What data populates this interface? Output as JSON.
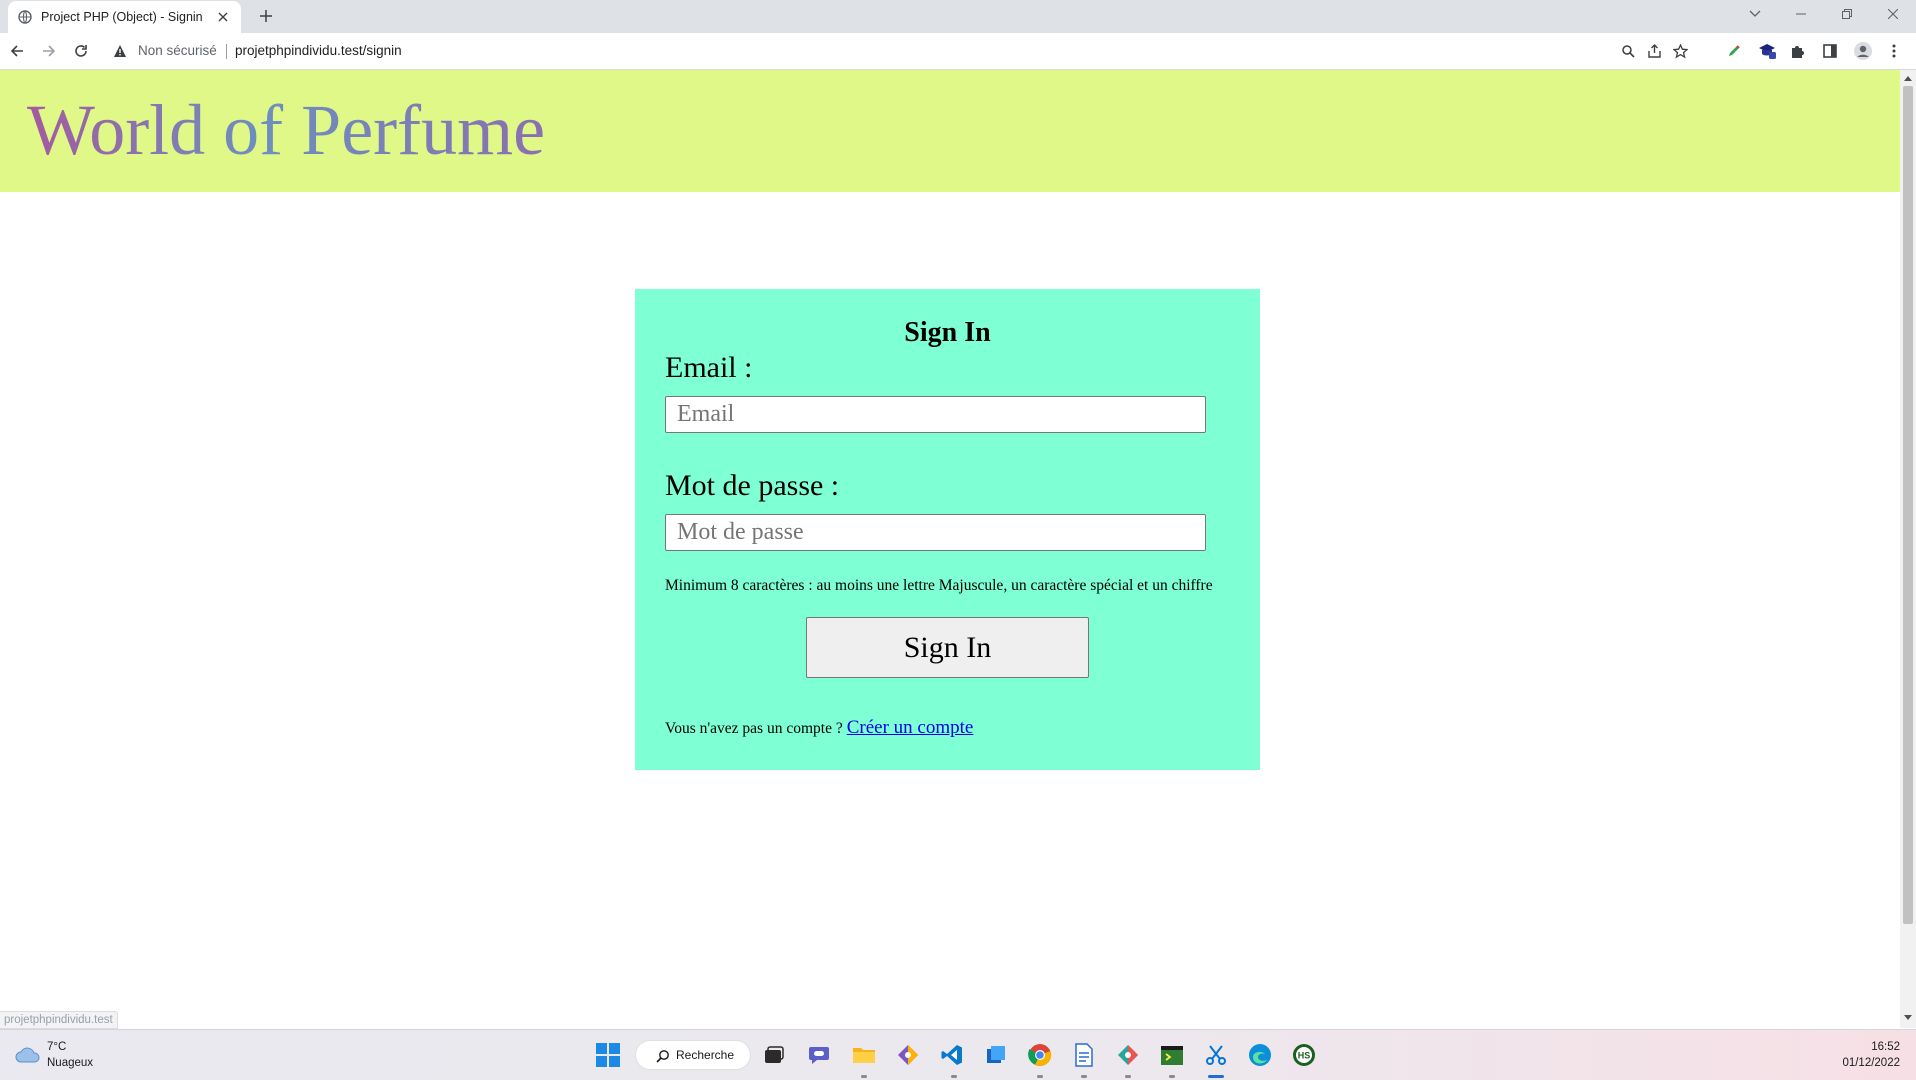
{
  "browser": {
    "tab_title": "Project PHP (Object) - Signin",
    "security_label": "Non sécurisé",
    "url": "projetphpindividu.test/signin",
    "status_url": "projetphpindividu.test"
  },
  "header": {
    "site_title": "World of Perfume"
  },
  "form": {
    "title": "Sign In",
    "email_label": "Email :",
    "email_placeholder": "Email",
    "password_label": "Mot de passe :",
    "password_placeholder": "Mot de passe",
    "password_hint": "Minimum 8 caractères : au moins une lettre Majuscule, un caractère spécial et un chiffre",
    "submit_label": "Sign In",
    "signup_question": "Vous n'avez pas un compte ?",
    "signup_link": "Créer un compte"
  },
  "taskbar": {
    "weather_temp": "7°C",
    "weather_desc": "Nuageux",
    "search_label": "Recherche",
    "time": "16:52",
    "date": "01/12/2022",
    "apps": [
      "start-icon",
      "task-view-icon",
      "teams-chat-icon",
      "file-explorer-icon",
      "git-client-icon",
      "vscode-icon",
      "office-icon",
      "chrome-icon",
      "notepad-icon",
      "git-client-icon-2",
      "terminal-icon",
      "snipping-tool-icon",
      "edge-icon",
      "hs-app-icon"
    ]
  },
  "colors": {
    "header_bg": "#dff887",
    "card_bg": "#7fffd4",
    "link": "#0000ee"
  }
}
